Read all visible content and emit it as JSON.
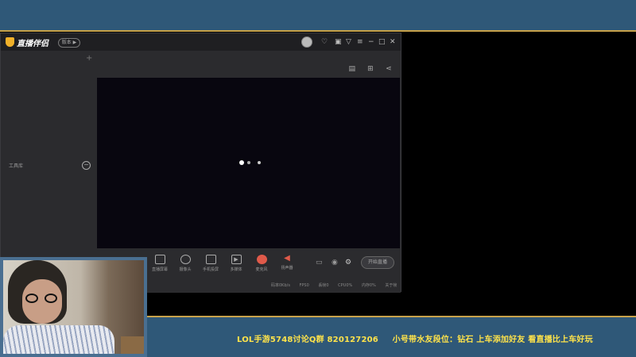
{
  "overlay": {
    "ticker_left": "LOL手游5748讨论Q群 820127206",
    "ticker_right": "小号带水友段位：钻石  上车添加好友 看直播比上车好玩"
  },
  "app": {
    "logo_text": "直播伴侣",
    "version_badge": "版本 ▶",
    "sidebar_label": "工具库",
    "tools": [
      {
        "label": "直播屏幕",
        "icon": "screen-icon"
      },
      {
        "label": "摄像头",
        "icon": "camera-icon"
      },
      {
        "label": "手机投屏",
        "icon": "phone-cast-icon"
      },
      {
        "label": "多媒体",
        "icon": "media-icon"
      },
      {
        "label": "麦克风",
        "icon": "microphone-icon"
      },
      {
        "label": "扬声器",
        "icon": "speaker-icon"
      }
    ],
    "start_button": "开始直播",
    "status": [
      "码率0Kb/s",
      "FPS0",
      "丢帧0",
      "CPU0%",
      "内存0%",
      "关于帧"
    ]
  },
  "colors": {
    "overlay_bar": "#2f5878",
    "overlay_border": "#c7a24a",
    "ticker_text": "#ffe34a",
    "app_bg": "#2b2b2e",
    "preview_bg": "#08060f"
  }
}
